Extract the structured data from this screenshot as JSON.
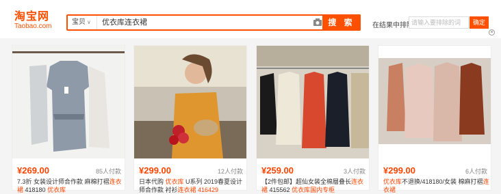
{
  "header": {
    "logo_cn": "淘宝网",
    "logo_en": "Taobao.com",
    "search_scope": "宝贝",
    "search_query": "优衣库连衣裙",
    "search_button": "搜 索",
    "exclude_label": "在结果中排除",
    "exclude_placeholder": "请输入要排除的词",
    "exclude_button": "确定",
    "close": "×"
  },
  "accent": "#ff5000",
  "products": [
    {
      "price": "¥269.00",
      "sold": "85人付款",
      "title_a": "7.3折 女装设计师合作款 麻棉打褶",
      "title_b": "连衣裙",
      "title_c": " 418180 ",
      "title_d": "优衣库"
    },
    {
      "price": "¥299.00",
      "sold": "12人付款",
      "title_a": "日本代购 ",
      "title_b": "优衣库",
      "title_c": " U系列 2019春夏设计师合作款 衬衫",
      "title_d": "连衣裙 416429"
    },
    {
      "price": "¥259.00",
      "sold": "3人付款",
      "title_a": "【2件包邮】超仙女装全棉層叠长",
      "title_b": "连衣裙",
      "title_c": " 415562 ",
      "title_d": "优衣库国内专柜"
    },
    {
      "price": "¥299.00",
      "sold": "6人付款",
      "title_a": "",
      "title_b": "优衣库",
      "title_c": "不退换/418180/女装 棉麻打褶",
      "title_d": "连衣裙"
    }
  ]
}
